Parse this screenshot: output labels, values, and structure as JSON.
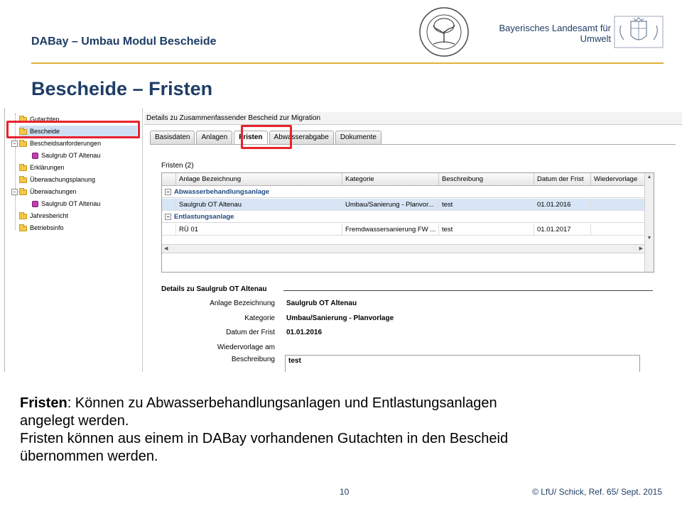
{
  "header": {
    "subtitle": "DABay – Umbau Modul Bescheide",
    "org_line1": "Bayerisches Landesamt für",
    "org_line2": "Umwelt",
    "title": "Bescheide – Fristen",
    "accent_color": "#e0b13b",
    "title_color": "#1f3d66"
  },
  "tree": {
    "items": [
      {
        "label": "Gutachten",
        "icon": "folder-icon"
      },
      {
        "label": "Bescheide",
        "icon": "folder-icon"
      },
      {
        "label": "Bescheidsanforderungen",
        "icon": "folder-icon"
      },
      {
        "label": "Saulgrub OT Altenau",
        "icon": "item-icon"
      },
      {
        "label": "Erklärungen",
        "icon": "folder-icon"
      },
      {
        "label": "Überwachungsplanung",
        "icon": "folder-icon"
      },
      {
        "label": "Überwachungen",
        "icon": "folder-icon"
      },
      {
        "label": "Saulgrub OT Altenau",
        "icon": "item-icon"
      },
      {
        "label": "Jahresbericht",
        "icon": "folder-icon"
      },
      {
        "label": "Betriebsinfo",
        "icon": "folder-icon"
      }
    ]
  },
  "panel": {
    "title": "Details zu Zusammenfassender Bescheid zur Migration",
    "tabs": [
      "Basisdaten",
      "Anlagen",
      "Fristen",
      "Abwasserabgabe",
      "Dokumente"
    ],
    "active_tab": "Fristen",
    "fristen_label": "Fristen  (2)",
    "columns": [
      "Anlage Bezeichnung",
      "Kategorie",
      "Beschreibung",
      "Datum der Frist",
      "Wiedervorlage"
    ],
    "groups": [
      {
        "name": "Abwasserbehandlungsanlage",
        "rows": [
          [
            "Saulgrub OT Altenau",
            "Umbau/Sanierung - Planvor...",
            "test",
            "01.01.2016",
            ""
          ]
        ]
      },
      {
        "name": "Entlastungsanlage",
        "rows": [
          [
            "RÜ 01",
            "Fremdwassersanierung FW ...",
            "test",
            "01.01.2017",
            ""
          ]
        ]
      }
    ],
    "details": {
      "header": "Details zu Saulgrub OT Altenau",
      "fields": [
        {
          "label": "Anlage Bezeichnung",
          "value": "Saulgrub OT Altenau"
        },
        {
          "label": "Kategorie",
          "value": "Umbau/Sanierung - Planvorlage"
        },
        {
          "label": "Datum der Frist",
          "value": "01.01.2016"
        },
        {
          "label": "Wiedervorlage am",
          "value": ""
        },
        {
          "label": "Beschreibung",
          "value": "test"
        }
      ]
    },
    "highlight_color": "#e8222b"
  },
  "body": {
    "bold_lead": "Fristen",
    "line1_rest": ": Können zu Abwasserbehandlungsanlagen  und Entlastungsanlagen",
    "line2": "angelegt werden.",
    "line3": "Fristen können aus einem in DABay vorhandenen Gutachten in den Bescheid",
    "line4": "übernommen werden."
  },
  "footer": {
    "page": "10",
    "copyright": "© LfU/ Schick, Ref. 65/ Sept. 2015"
  }
}
